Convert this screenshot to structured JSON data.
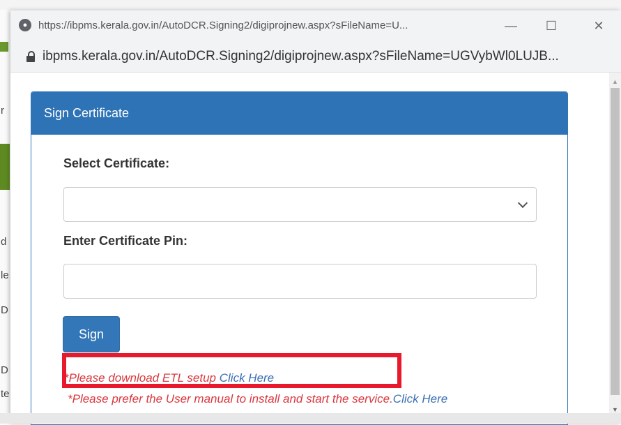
{
  "background": {
    "side_chars": [
      "r",
      "d",
      "le",
      "D",
      "D",
      "te"
    ]
  },
  "window": {
    "tab_url": "https://ibpms.kerala.gov.in/AutoDCR.Signing2/digiprojnew.aspx?sFileName=U...",
    "address_url": "ibpms.kerala.gov.in/AutoDCR.Signing2/digiprojnew.aspx?sFileName=UGVybWl0LUJB...",
    "minimize_glyph": "—",
    "maximize_glyph": "☐",
    "close_glyph": "✕"
  },
  "panel": {
    "heading": "Sign Certificate",
    "select_label": "Select Certificate:",
    "select_value": "",
    "pin_label": "Enter Certificate Pin:",
    "pin_value": "",
    "sign_button": "Sign",
    "note1_text": "*Please download ETL setup ",
    "note1_link": "Click Here",
    "note2_text": "*Please prefer the User manual to install and start the service.",
    "note2_link": "Click Here"
  },
  "colors": {
    "panel_heading_bg": "#2e73b5",
    "button_bg": "#3377b8",
    "note_red": "#d9373f",
    "link_blue": "#3a6fb3",
    "highlight_red": "#e8192c"
  }
}
